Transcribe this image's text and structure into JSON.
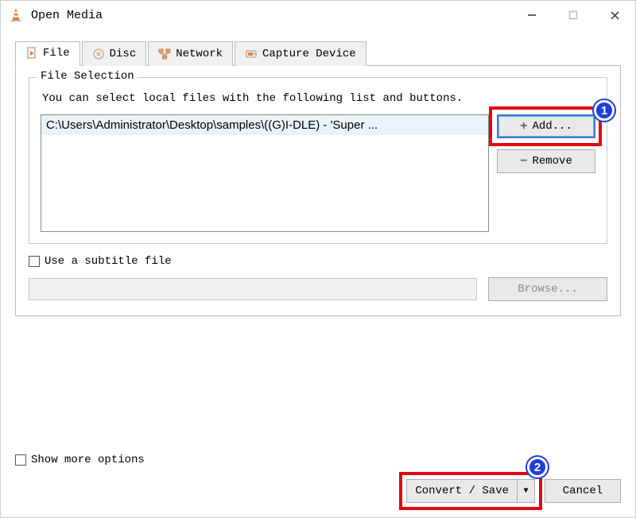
{
  "window": {
    "title": "Open Media"
  },
  "tabs": {
    "file": "File",
    "disc": "Disc",
    "network": "Network",
    "capture": "Capture Device"
  },
  "file_selection": {
    "legend": "File Selection",
    "hint": "You can select local files with the following list and buttons.",
    "files": [
      "C:\\Users\\Administrator\\Desktop\\samples\\((G)I-DLE) - 'Super ..."
    ],
    "add_label": "Add...",
    "remove_label": "Remove"
  },
  "subtitle": {
    "checkbox_label": "Use a subtitle file",
    "browse_label": "Browse..."
  },
  "more_options_label": "Show more options",
  "actions": {
    "convert_save": "Convert / Save",
    "cancel": "Cancel"
  },
  "callouts": {
    "badge1": "1",
    "badge2": "2"
  }
}
